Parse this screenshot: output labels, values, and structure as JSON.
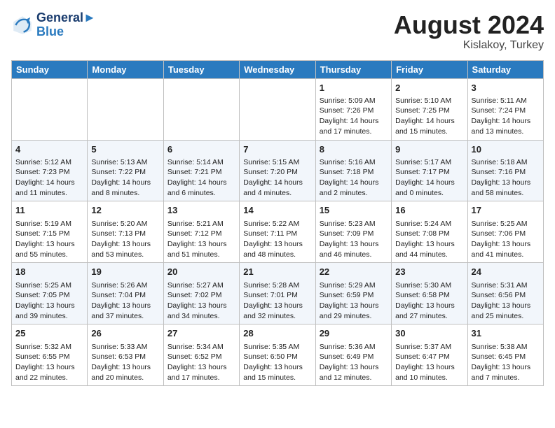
{
  "header": {
    "logo_line1": "General",
    "logo_line2": "Blue",
    "month": "August 2024",
    "location": "Kislakoy, Turkey"
  },
  "days_of_week": [
    "Sunday",
    "Monday",
    "Tuesday",
    "Wednesday",
    "Thursday",
    "Friday",
    "Saturday"
  ],
  "weeks": [
    [
      {
        "day": "",
        "info": ""
      },
      {
        "day": "",
        "info": ""
      },
      {
        "day": "",
        "info": ""
      },
      {
        "day": "",
        "info": ""
      },
      {
        "day": "1",
        "info": "Sunrise: 5:09 AM\nSunset: 7:26 PM\nDaylight: 14 hours\nand 17 minutes."
      },
      {
        "day": "2",
        "info": "Sunrise: 5:10 AM\nSunset: 7:25 PM\nDaylight: 14 hours\nand 15 minutes."
      },
      {
        "day": "3",
        "info": "Sunrise: 5:11 AM\nSunset: 7:24 PM\nDaylight: 14 hours\nand 13 minutes."
      }
    ],
    [
      {
        "day": "4",
        "info": "Sunrise: 5:12 AM\nSunset: 7:23 PM\nDaylight: 14 hours\nand 11 minutes."
      },
      {
        "day": "5",
        "info": "Sunrise: 5:13 AM\nSunset: 7:22 PM\nDaylight: 14 hours\nand 8 minutes."
      },
      {
        "day": "6",
        "info": "Sunrise: 5:14 AM\nSunset: 7:21 PM\nDaylight: 14 hours\nand 6 minutes."
      },
      {
        "day": "7",
        "info": "Sunrise: 5:15 AM\nSunset: 7:20 PM\nDaylight: 14 hours\nand 4 minutes."
      },
      {
        "day": "8",
        "info": "Sunrise: 5:16 AM\nSunset: 7:18 PM\nDaylight: 14 hours\nand 2 minutes."
      },
      {
        "day": "9",
        "info": "Sunrise: 5:17 AM\nSunset: 7:17 PM\nDaylight: 14 hours\nand 0 minutes."
      },
      {
        "day": "10",
        "info": "Sunrise: 5:18 AM\nSunset: 7:16 PM\nDaylight: 13 hours\nand 58 minutes."
      }
    ],
    [
      {
        "day": "11",
        "info": "Sunrise: 5:19 AM\nSunset: 7:15 PM\nDaylight: 13 hours\nand 55 minutes."
      },
      {
        "day": "12",
        "info": "Sunrise: 5:20 AM\nSunset: 7:13 PM\nDaylight: 13 hours\nand 53 minutes."
      },
      {
        "day": "13",
        "info": "Sunrise: 5:21 AM\nSunset: 7:12 PM\nDaylight: 13 hours\nand 51 minutes."
      },
      {
        "day": "14",
        "info": "Sunrise: 5:22 AM\nSunset: 7:11 PM\nDaylight: 13 hours\nand 48 minutes."
      },
      {
        "day": "15",
        "info": "Sunrise: 5:23 AM\nSunset: 7:09 PM\nDaylight: 13 hours\nand 46 minutes."
      },
      {
        "day": "16",
        "info": "Sunrise: 5:24 AM\nSunset: 7:08 PM\nDaylight: 13 hours\nand 44 minutes."
      },
      {
        "day": "17",
        "info": "Sunrise: 5:25 AM\nSunset: 7:06 PM\nDaylight: 13 hours\nand 41 minutes."
      }
    ],
    [
      {
        "day": "18",
        "info": "Sunrise: 5:25 AM\nSunset: 7:05 PM\nDaylight: 13 hours\nand 39 minutes."
      },
      {
        "day": "19",
        "info": "Sunrise: 5:26 AM\nSunset: 7:04 PM\nDaylight: 13 hours\nand 37 minutes."
      },
      {
        "day": "20",
        "info": "Sunrise: 5:27 AM\nSunset: 7:02 PM\nDaylight: 13 hours\nand 34 minutes."
      },
      {
        "day": "21",
        "info": "Sunrise: 5:28 AM\nSunset: 7:01 PM\nDaylight: 13 hours\nand 32 minutes."
      },
      {
        "day": "22",
        "info": "Sunrise: 5:29 AM\nSunset: 6:59 PM\nDaylight: 13 hours\nand 29 minutes."
      },
      {
        "day": "23",
        "info": "Sunrise: 5:30 AM\nSunset: 6:58 PM\nDaylight: 13 hours\nand 27 minutes."
      },
      {
        "day": "24",
        "info": "Sunrise: 5:31 AM\nSunset: 6:56 PM\nDaylight: 13 hours\nand 25 minutes."
      }
    ],
    [
      {
        "day": "25",
        "info": "Sunrise: 5:32 AM\nSunset: 6:55 PM\nDaylight: 13 hours\nand 22 minutes."
      },
      {
        "day": "26",
        "info": "Sunrise: 5:33 AM\nSunset: 6:53 PM\nDaylight: 13 hours\nand 20 minutes."
      },
      {
        "day": "27",
        "info": "Sunrise: 5:34 AM\nSunset: 6:52 PM\nDaylight: 13 hours\nand 17 minutes."
      },
      {
        "day": "28",
        "info": "Sunrise: 5:35 AM\nSunset: 6:50 PM\nDaylight: 13 hours\nand 15 minutes."
      },
      {
        "day": "29",
        "info": "Sunrise: 5:36 AM\nSunset: 6:49 PM\nDaylight: 13 hours\nand 12 minutes."
      },
      {
        "day": "30",
        "info": "Sunrise: 5:37 AM\nSunset: 6:47 PM\nDaylight: 13 hours\nand 10 minutes."
      },
      {
        "day": "31",
        "info": "Sunrise: 5:38 AM\nSunset: 6:45 PM\nDaylight: 13 hours\nand 7 minutes."
      }
    ]
  ]
}
